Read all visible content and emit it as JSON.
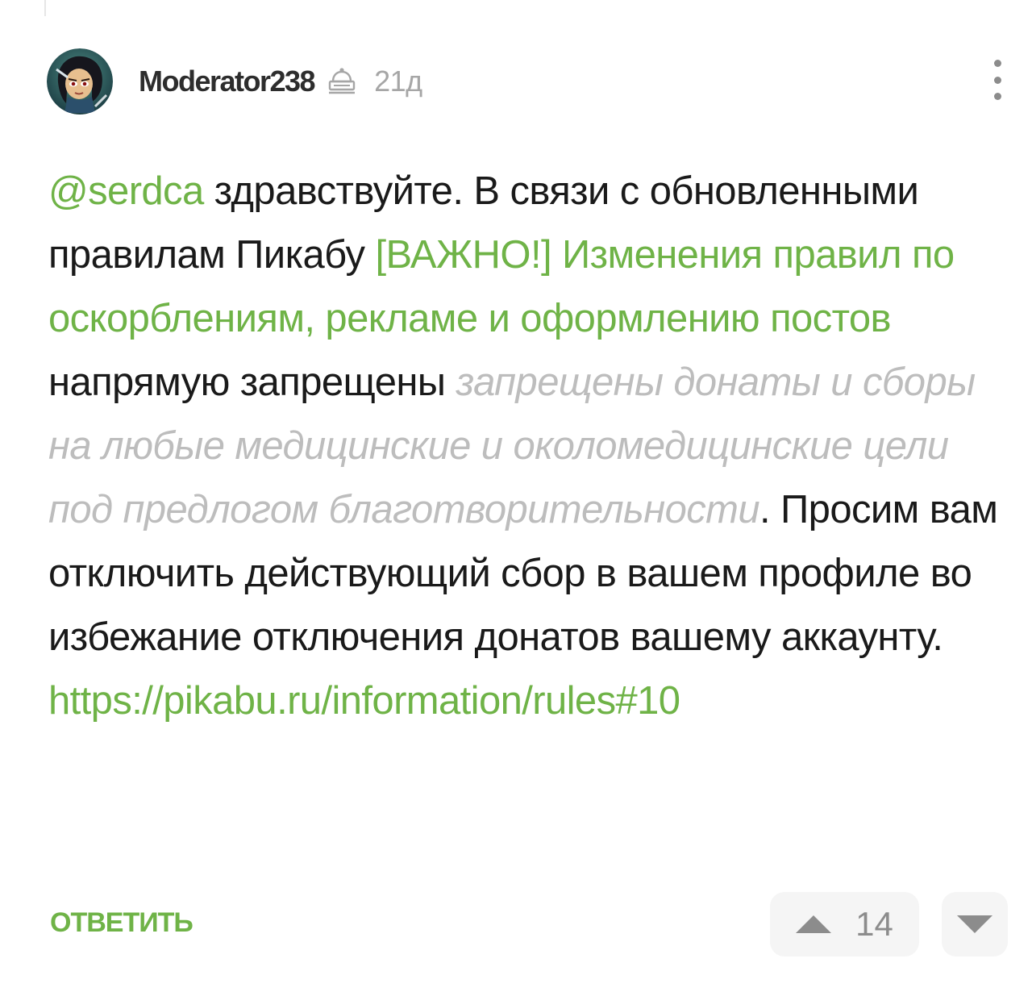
{
  "comment": {
    "author": "Moderator238",
    "time": "21д",
    "body": {
      "mention": "@serdca",
      "text_1": " здравствуйте. В связи с обновленными правилам Пикабу ",
      "rules_link": "[ВАЖНО!] Изменения правил по оскорблениям, рекламе и оформлению постов",
      "text_2": " напрямую запрещены ",
      "spoiler": "запрещены донаты и сборы на любые медицинские и околомедицинские цели под предлогом благотворительности",
      "text_3": ". Просим вам отключить действующий сбор в вашем профиле во избежание отключения донатов вашему аккаунту. ",
      "url": "https://pikabu.ru/information/rules#10"
    },
    "reply_label": "ОТВЕТИТЬ",
    "rating": "14"
  },
  "icons": {
    "avatar": "avatar",
    "moderator": "moderator-cap-icon",
    "more": "more-vertical-icon",
    "upvote": "arrow-up-icon",
    "downvote": "arrow-down-icon"
  },
  "colors": {
    "link": "#6fb347",
    "muted": "#a6a6a6",
    "spoiler": "#bdbdbd"
  }
}
